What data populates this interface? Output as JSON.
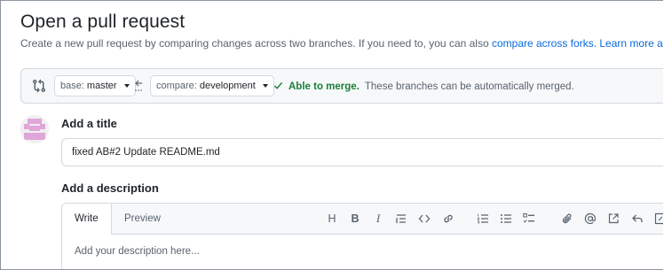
{
  "header": {
    "title": "Open a pull request",
    "subtitle_text": "Create a new pull request by comparing changes across two branches. If you need to, you can also",
    "compare_link": "compare across forks.",
    "learn_link": "Learn more about dif"
  },
  "compare": {
    "base_label": "base:",
    "base_value": "master",
    "compare_label": "compare:",
    "compare_value": "development",
    "merge_ok": "Able to merge.",
    "merge_desc": "These branches can be automatically merged."
  },
  "form": {
    "title_label": "Add a title",
    "title_value": "fixed AB#2 Update README.md",
    "description_label": "Add a description",
    "tabs": [
      "Write",
      "Preview"
    ],
    "description_placeholder": "Add your description here..."
  },
  "toolbar": {
    "heading_label": "H",
    "bold_label": "B",
    "italic_label": "I",
    "icons": [
      "heading-icon",
      "bold-icon",
      "italic-icon",
      "quote-icon",
      "code-icon",
      "link-icon",
      "numbered-list-icon",
      "bulleted-list-icon",
      "task-list-icon",
      "attach-icon",
      "mention-icon",
      "reference-icon",
      "reply-icon",
      "fullscreen-icon"
    ]
  },
  "colors": {
    "accent": "#0969da",
    "success": "#1a7f37",
    "muted": "#59636e",
    "avatar": "#e0a6d8"
  }
}
